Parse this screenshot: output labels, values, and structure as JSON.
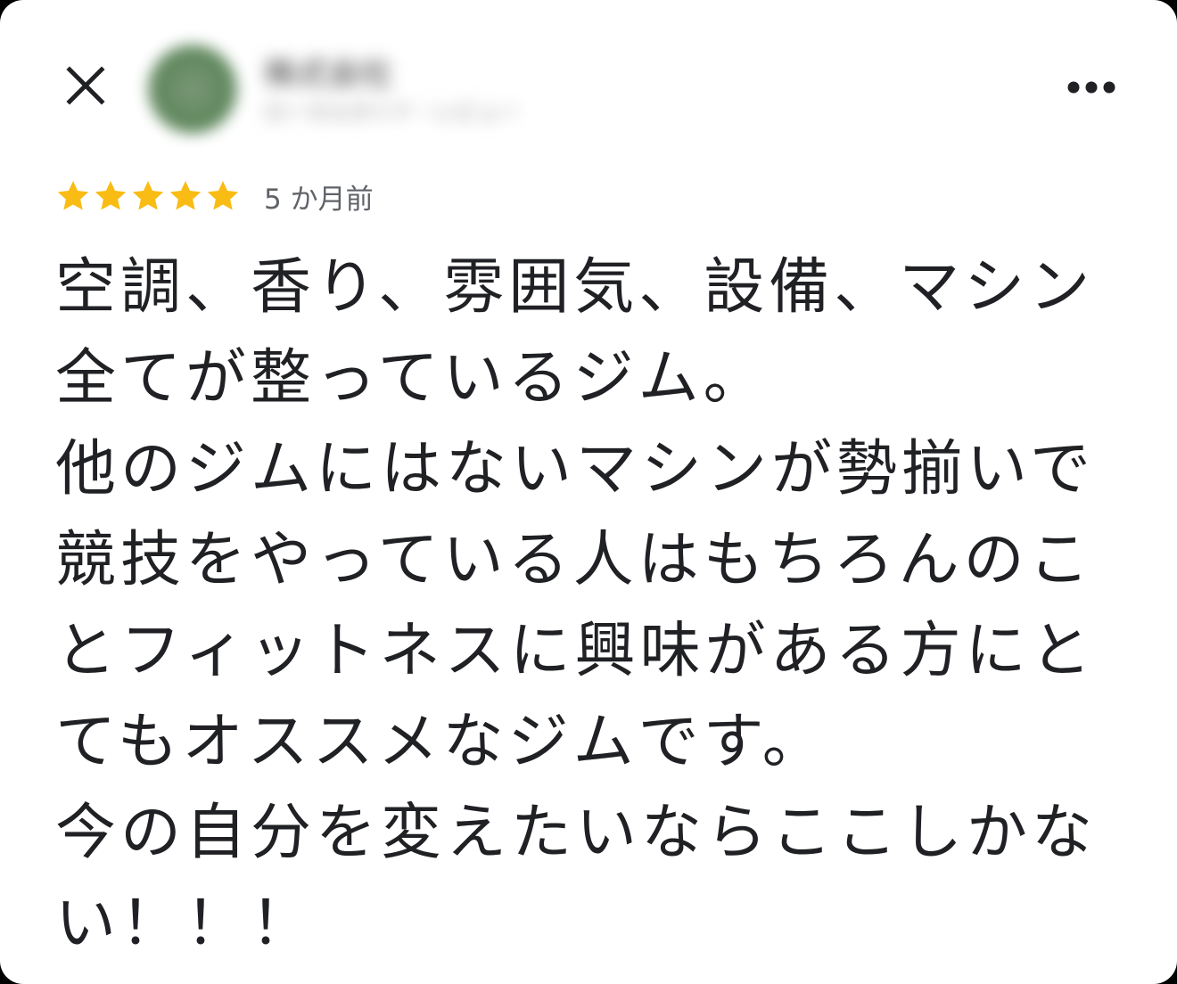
{
  "colors": {
    "star": "#f9bc15",
    "text": "#202124",
    "secondary_text": "#5f6368",
    "background": "#ffffff"
  },
  "header": {
    "close_icon": "close-icon",
    "more_icon": "more-horizontal-icon",
    "reviewer_name": "株式会社",
    "reviewer_meta": "ローカルガイド・レビュー"
  },
  "rating": {
    "stars": 5,
    "max_stars": 5,
    "time_ago": "5 か月前"
  },
  "review": {
    "lines": [
      "空調、香り、雰囲気、設備、マシン",
      "全てが整っているジム。",
      "他のジムにはないマシンが勢揃いで",
      "競技をやっている人はもちろんのこ",
      "とフィットネスに興味がある方にと",
      "てもオススメなジムです。",
      "今の自分を変えたいならここしかな",
      "い！！！"
    ]
  }
}
